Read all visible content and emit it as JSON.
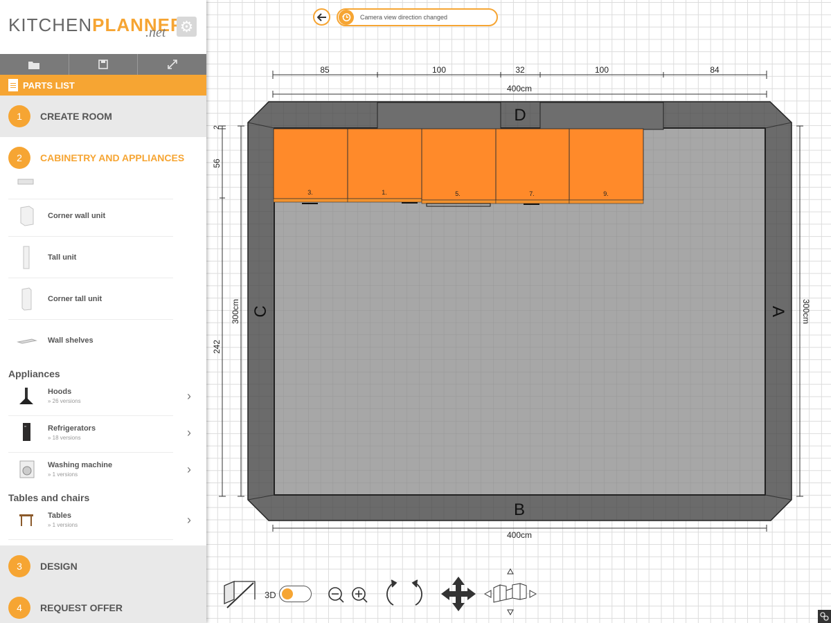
{
  "app": {
    "logo_part1": "KITCHEN",
    "logo_part2": "PLANNER",
    "logo_net": ".net"
  },
  "toolbar": {
    "buttons": [
      {
        "icon": "folder-icon"
      },
      {
        "icon": "save-icon"
      },
      {
        "icon": "expand-icon"
      }
    ]
  },
  "parts_list": {
    "label": "PARTS LIST",
    "icon": "document-icon"
  },
  "steps": [
    {
      "num": "1",
      "label": "CREATE ROOM"
    },
    {
      "num": "2",
      "label": "CABINETRY AND APPLIANCES"
    },
    {
      "num": "3",
      "label": "DESIGN"
    },
    {
      "num": "4",
      "label": "REQUEST OFFER"
    }
  ],
  "cabinet_items": [
    {
      "name": "Corner wall unit"
    },
    {
      "name": "Tall unit"
    },
    {
      "name": "Corner tall unit"
    },
    {
      "name": "Wall shelves"
    }
  ],
  "appliances": {
    "heading": "Appliances",
    "items": [
      {
        "name": "Hoods",
        "versions": "» 26 versions"
      },
      {
        "name": "Refrigerators",
        "versions": "» 18 versions"
      },
      {
        "name": "Washing machine",
        "versions": "» 1 versions"
      }
    ]
  },
  "tables": {
    "heading": "Tables and chairs",
    "items": [
      {
        "name": "Tables",
        "versions": "» 1 versions"
      }
    ]
  },
  "notification": {
    "text": "Camera view direction changed"
  },
  "plan": {
    "top_segments": [
      "85",
      "100",
      "32",
      "100",
      "84"
    ],
    "width_label": "400cm",
    "bottom_width_label": "400cm",
    "height_label_left": "300cm",
    "height_label_right": "300cm",
    "left_segments": [
      "2",
      "56",
      "242"
    ],
    "walls": {
      "top": "D",
      "right": "A",
      "bottom": "B",
      "left": "C"
    },
    "cabinets": [
      "3.",
      "1.",
      "5.",
      "7.",
      "9."
    ],
    "colors": {
      "cabinet": "#ff8a2a",
      "wall": "#6b6b6b",
      "floor": "#a7a7a7",
      "accent": "#f6a533"
    }
  },
  "view_controls": {
    "toggle_label": "3D",
    "toggle_state": "on"
  }
}
